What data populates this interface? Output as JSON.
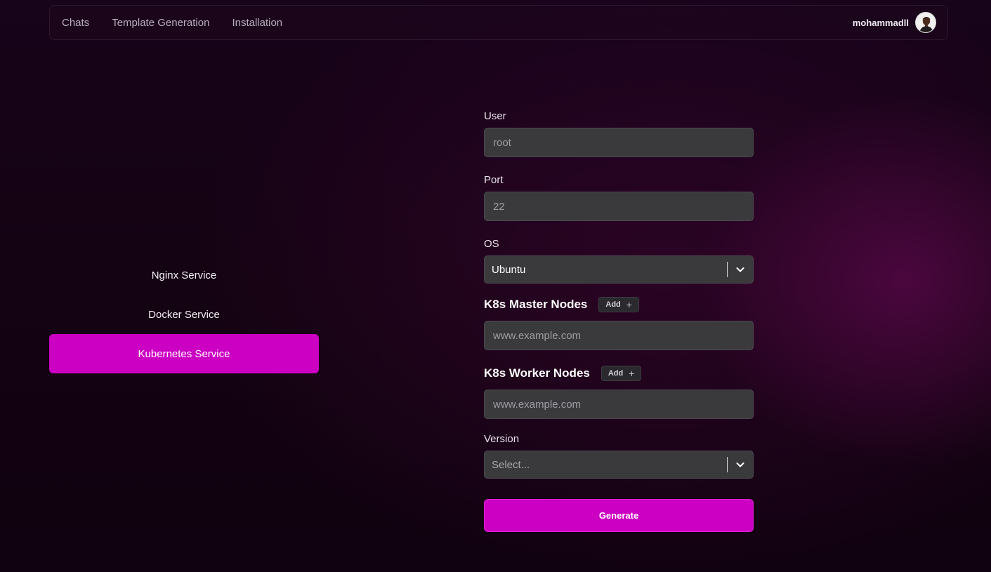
{
  "nav": {
    "links": [
      {
        "label": "Chats"
      },
      {
        "label": "Template Generation"
      },
      {
        "label": "Installation"
      }
    ],
    "username": "mohammadll"
  },
  "services": [
    {
      "label": "Nginx Service",
      "active": false
    },
    {
      "label": "Docker Service",
      "active": false
    },
    {
      "label": "Kubernetes Service",
      "active": true
    }
  ],
  "form": {
    "user": {
      "label": "User",
      "placeholder": "root"
    },
    "port": {
      "label": "Port",
      "placeholder": "22"
    },
    "os": {
      "label": "OS",
      "value": "Ubuntu"
    },
    "master_nodes": {
      "label": "K8s Master Nodes",
      "add_label": "Add",
      "placeholder": "www.example.com"
    },
    "worker_nodes": {
      "label": "K8s Worker Nodes",
      "add_label": "Add",
      "placeholder": "www.example.com"
    },
    "version": {
      "label": "Version",
      "placeholder": "Select..."
    },
    "generate_label": "Generate"
  },
  "colors": {
    "accent": "#cc00c3",
    "input_bg": "#3a3a3d"
  },
  "icons": {
    "dropdown": "chevron-down-icon",
    "add": "plus-icon"
  }
}
